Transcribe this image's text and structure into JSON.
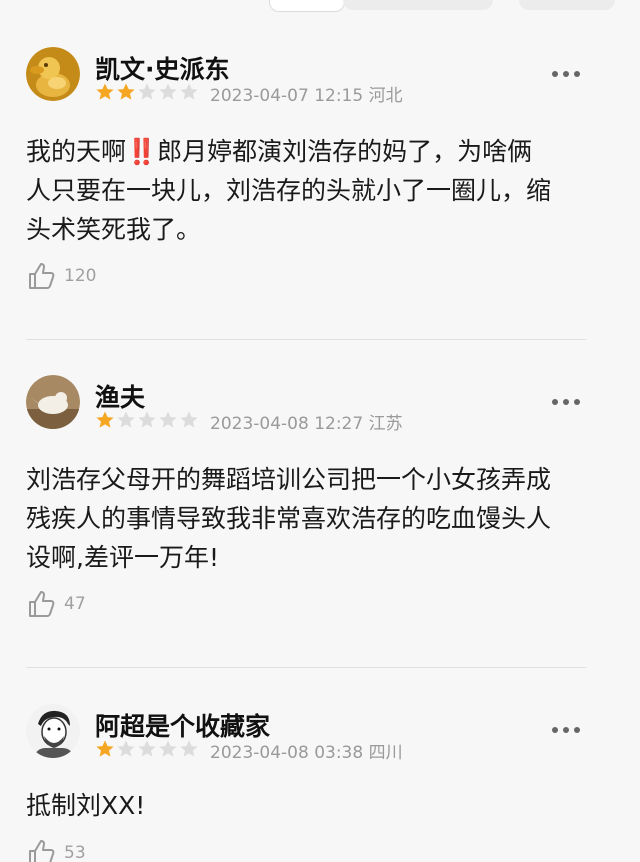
{
  "reviews": [
    {
      "username": "凯文·史派东",
      "rating": 2,
      "max_rating": 5,
      "date": "2023-04-07 12:15",
      "location": "河北",
      "content_before": "我的天啊",
      "content_emoji": "‼️",
      "content_after": "郎月婷都演刘浩存的妈了，为啥俩\n人只要在一块儿，刘浩存的头就小了一圈儿，缩\n头术笑死我了。",
      "likes": "120"
    },
    {
      "username": "渔夫",
      "rating": 1,
      "max_rating": 5,
      "date": "2023-04-08 12:27",
      "location": "江苏",
      "content": "刘浩存父母开的舞蹈培训公司把一个小女孩弄成\n残疾人的事情导致我非常喜欢浩存的吃血馒头人\n设啊,差评一万年!",
      "likes": "47"
    },
    {
      "username": "阿超是个收藏家",
      "rating": 1,
      "max_rating": 5,
      "date": "2023-04-08 03:38",
      "location": "四川",
      "content": "抵制刘XX!",
      "likes": "53"
    }
  ],
  "colors": {
    "star_filled": "#f5a623",
    "star_empty": "#dcdcdc",
    "meta_text": "#9a9a9a",
    "emoji_red": "#e0342f"
  },
  "icons": {
    "more": "more-dots-icon",
    "like": "thumbs-up-icon",
    "star": "star-icon"
  }
}
